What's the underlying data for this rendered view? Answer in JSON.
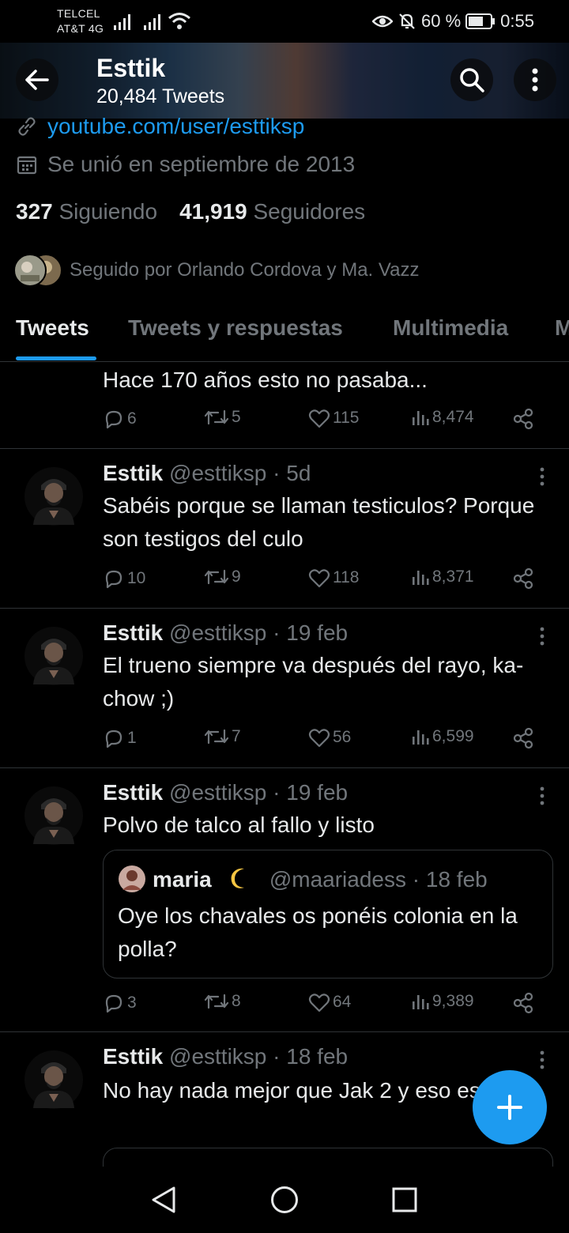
{
  "status_bar": {
    "carrier1": "TELCEL",
    "carrier2": "AT&T 4G",
    "battery": "60 %",
    "time": "0:55"
  },
  "header": {
    "name": "Esttik",
    "tweet_count": "20,484 Tweets"
  },
  "profile": {
    "website": "youtube.com/user/esttiksp",
    "joined": "Se unió en septiembre de 2013",
    "following_count": "327",
    "following_label": "Siguiendo",
    "followers_count": "41,919",
    "followers_label": "Seguidores",
    "followed_by": "Seguido por Orlando Cordova y Ma. Vazz"
  },
  "tabs": [
    "Tweets",
    "Tweets y respuestas",
    "Multimedia",
    "M"
  ],
  "tweets": [
    {
      "text": "Hace 170 años esto no pasaba...",
      "replies": "6",
      "retweets": "5",
      "likes": "115",
      "views": "8,474"
    },
    {
      "name": "Esttik",
      "handle": "@esttiksp · 5d",
      "text": "Sabéis porque se llaman testiculos? Porque son testigos del culo",
      "replies": "10",
      "retweets": "9",
      "likes": "118",
      "views": "8,371"
    },
    {
      "name": "Esttik",
      "handle": "@esttiksp · 19 feb",
      "text": "El trueno siempre va después del rayo, ka-chow ;)",
      "replies": "1",
      "retweets": "7",
      "likes": "56",
      "views": "6,599"
    },
    {
      "name": "Esttik",
      "handle": "@esttiksp · 19 feb",
      "text": "Polvo de talco al fallo y listo",
      "quote": {
        "name": "maria",
        "handle": "@maariadess · 18 feb",
        "text": "Oye los chavales os ponéis colonia en la polla?"
      },
      "replies": "3",
      "retweets": "8",
      "likes": "64",
      "views": "9,389"
    },
    {
      "name": "Esttik",
      "handle": "@esttiksp · 18 feb",
      "text": "No hay nada mejor que Jak 2 y eso es así."
    }
  ],
  "colors": {
    "accent": "#1d9bf0",
    "background": "#000000",
    "muted": "#71767b",
    "text": "#e7e9ea",
    "divider": "#2f3336"
  }
}
